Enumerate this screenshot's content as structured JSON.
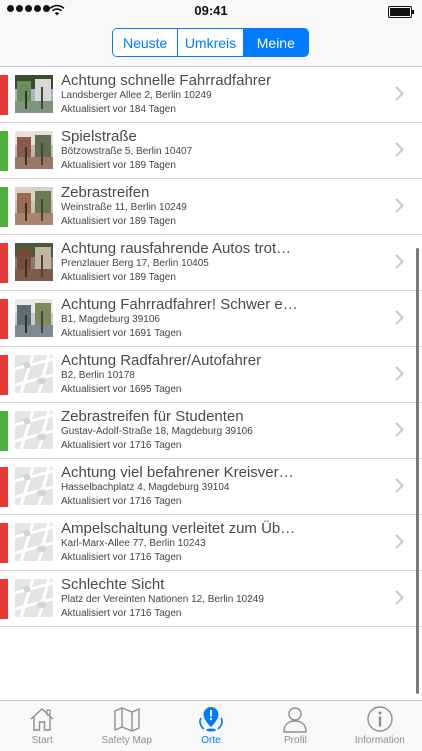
{
  "status_bar": {
    "time": "09:41",
    "icons": [
      "signal-dots-icon",
      "wifi-icon",
      "battery-icon"
    ]
  },
  "segments": [
    {
      "label": "Neuste",
      "active": false
    },
    {
      "label": "Umkreis",
      "active": false
    },
    {
      "label": "Meine",
      "active": true
    }
  ],
  "colors": {
    "accent": "#007aff",
    "danger": "#e53935",
    "ok": "#4caf3c"
  },
  "places": [
    {
      "title": "Achtung schnelle Fahrradfahrer",
      "address": "Landsberger Allee 2, Berlin 10249",
      "updated": "Aktualisiert vor 184 Tagen",
      "status": "danger",
      "thumb": "photo"
    },
    {
      "title": "Spielstraße",
      "address": "Bötzowstraße 5, Berlin 10407",
      "updated": "Aktualisiert vor 189 Tagen",
      "status": "ok",
      "thumb": "photo"
    },
    {
      "title": "Zebrastreifen",
      "address": "Weinstraße 11, Berlin 10249",
      "updated": "Aktualisiert vor 189 Tagen",
      "status": "ok",
      "thumb": "photo"
    },
    {
      "title": "Achtung rausfahrende Autos trot…",
      "address": "Prenzlauer Berg 17, Berlin 10405",
      "updated": "Aktualisiert vor 189 Tagen",
      "status": "danger",
      "thumb": "photo"
    },
    {
      "title": "Achtung Fahrradfahrer! Schwer e…",
      "address": "B1, Magdeburg 39106",
      "updated": "Aktualisiert vor 1691 Tagen",
      "status": "danger",
      "thumb": "photo"
    },
    {
      "title": "Achtung Radfahrer/Autofahrer",
      "address": "B2, Berlin 10178",
      "updated": "Aktualisiert vor 1695 Tagen",
      "status": "danger",
      "thumb": "map"
    },
    {
      "title": "Zebrastreifen für Studenten",
      "address": "Gustav-Adolf-Straße 18, Magdeburg 39106",
      "updated": "Aktualisiert vor 1716 Tagen",
      "status": "ok",
      "thumb": "map"
    },
    {
      "title": "Achtung viel befahrener Kreisver…",
      "address": "Hasselbachplatz 4, Magdeburg 39104",
      "updated": "Aktualisiert vor 1716 Tagen",
      "status": "danger",
      "thumb": "map"
    },
    {
      "title": "Ampelschaltung verleitet zum Üb…",
      "address": "Karl-Marx-Allee 77, Berlin 10243",
      "updated": "Aktualisiert vor 1716 Tagen",
      "status": "danger",
      "thumb": "map"
    },
    {
      "title": "Schlechte Sicht",
      "address": "Platz der Vereinten Nationen 12, Berlin 10249",
      "updated": "Aktualisiert vor 1716 Tagen",
      "status": "danger",
      "thumb": "map"
    }
  ],
  "tabs": [
    {
      "label": "Start",
      "icon": "home-icon",
      "active": false
    },
    {
      "label": "Safety Map",
      "icon": "map-icon",
      "active": false
    },
    {
      "label": "Orte",
      "icon": "places-icon",
      "active": true
    },
    {
      "label": "Profil",
      "icon": "profile-icon",
      "active": false
    },
    {
      "label": "Information",
      "icon": "info-icon",
      "active": false
    }
  ]
}
